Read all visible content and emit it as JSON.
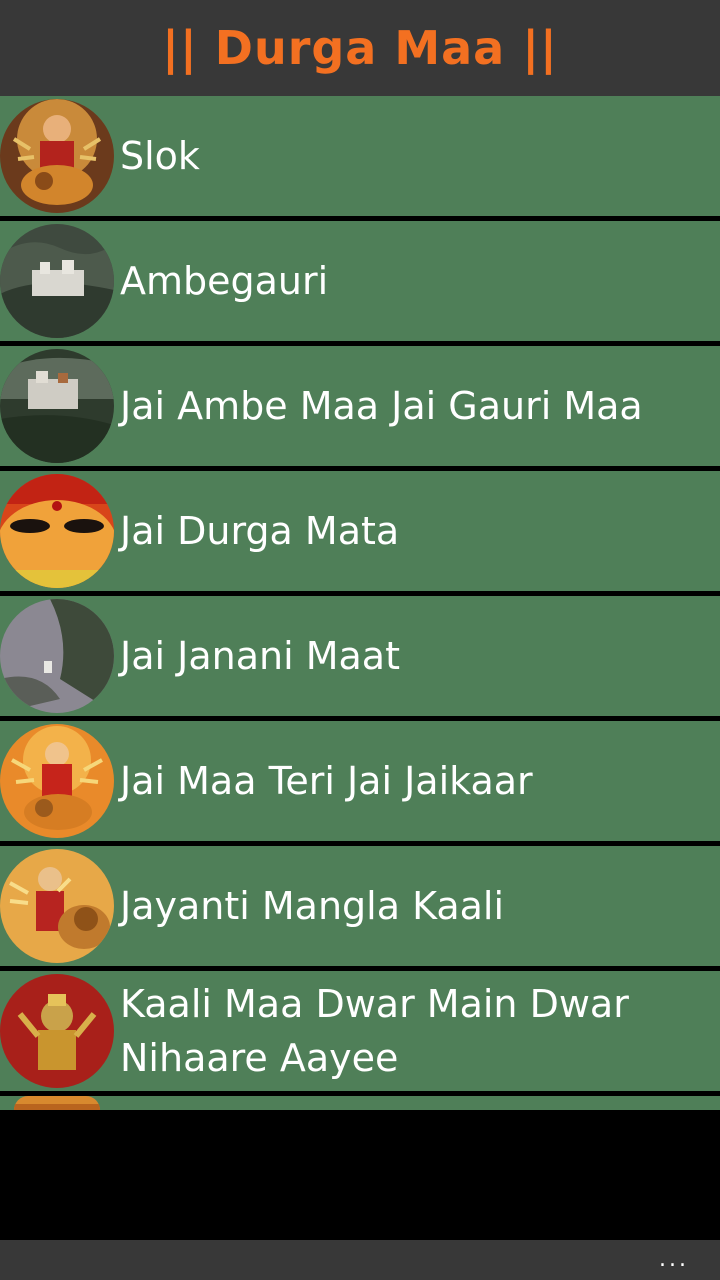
{
  "header": {
    "title": "|| Durga Maa ||"
  },
  "colors": {
    "header_bg": "#383838",
    "title": "#f37021",
    "item_bg": "#4f7f58",
    "separator": "#000000",
    "text": "#ffffff"
  },
  "list": {
    "items": [
      {
        "label": "Slok",
        "thumb": "durga-on-lion-image"
      },
      {
        "label": "Ambegauri",
        "thumb": "hill-temple-image"
      },
      {
        "label": "Jai Ambe Maa Jai Gauri Maa",
        "thumb": "temple-complex-image"
      },
      {
        "label": "Jai Durga Mata",
        "thumb": "durga-face-image"
      },
      {
        "label": "Jai Janani Maat",
        "thumb": "misty-mountain-image"
      },
      {
        "label": "Jai Maa Teri Jai Jaikaar",
        "thumb": "durga-on-lion-image"
      },
      {
        "label": "Jayanti Mangla Kaali",
        "thumb": "durga-on-lion-image"
      },
      {
        "label": "Kaali Maa Dwar Main Dwar Nihaare Aayee",
        "thumb": "durga-idol-image"
      }
    ]
  },
  "app_bar": {
    "more_label": "..."
  }
}
